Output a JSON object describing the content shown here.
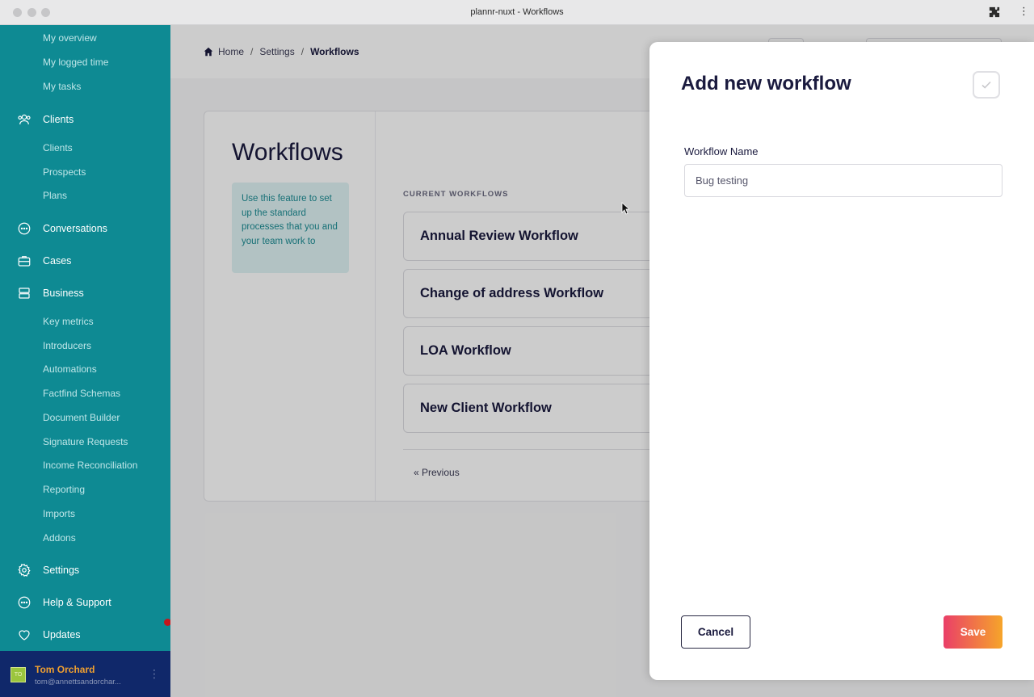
{
  "window": {
    "title": "plannr-nuxt - Workflows"
  },
  "sidebar": {
    "overview_items": [
      "My overview",
      "My logged time",
      "My tasks"
    ],
    "clients": {
      "label": "Clients",
      "icon": "users-icon",
      "items": [
        "Clients",
        "Prospects",
        "Plans"
      ]
    },
    "conversations": {
      "label": "Conversations",
      "icon": "chat-icon"
    },
    "cases": {
      "label": "Cases",
      "icon": "briefcase-icon"
    },
    "business": {
      "label": "Business",
      "icon": "server-icon",
      "items": [
        "Key metrics",
        "Introducers",
        "Automations",
        "Factfind Schemas",
        "Document Builder",
        "Signature Requests",
        "Income Reconciliation",
        "Reporting",
        "Imports",
        "Addons"
      ]
    },
    "settings": {
      "label": "Settings",
      "icon": "gear-icon"
    },
    "help": {
      "label": "Help & Support",
      "icon": "chat-icon"
    },
    "updates": {
      "label": "Updates",
      "icon": "heart-icon"
    },
    "user": {
      "initials": "TO",
      "name": "Tom Orchard",
      "email": "tom@annettsandorchar..."
    }
  },
  "breadcrumb": {
    "home": "Home",
    "settings": "Settings",
    "current": "Workflows"
  },
  "page": {
    "title": "Workflows",
    "info_text": "Use this feature to set up the standard processes that you and your team work to",
    "section_heading": "CURRENT WORKFLOWS",
    "workflows": [
      "Annual Review Workflow",
      "Change of address Workflow",
      "LOA Workflow",
      "New Client Workflow"
    ],
    "previous_label": "« Previous"
  },
  "drawer": {
    "title": "Add new workflow",
    "field_label": "Workflow Name",
    "field_value": "Bug testing",
    "cancel_label": "Cancel",
    "save_label": "Save"
  },
  "colors": {
    "sidebar": "#0e8a93",
    "userbar": "#10286a",
    "info_bg": "#dff3f4",
    "save_gradient_start": "#ea3f68",
    "save_gradient_end": "#f6a52a",
    "notification": "#c4161c"
  }
}
